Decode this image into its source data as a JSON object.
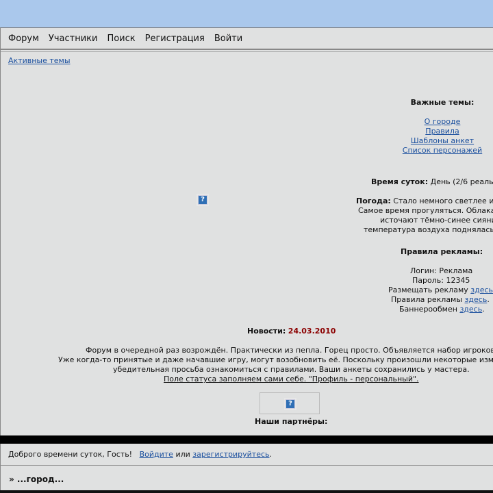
{
  "nav": {
    "items": [
      "Форум",
      "Участники",
      "Поиск",
      "Регистрация",
      "Войти"
    ]
  },
  "active_topics": "Активные темы",
  "important": {
    "title": "Важные темы:",
    "links": [
      "О городе",
      "Правила",
      "Шаблоны анкет",
      "Список персонажей"
    ]
  },
  "time": {
    "label": "Время суток:",
    "value": "День (2/6 реаль"
  },
  "weather": {
    "label": "Погода:",
    "line1": "Стало немного светлее и",
    "line2": "Самое время прогуляться. Облака",
    "line3": "источают тёмно-синее сияни",
    "line4": "температура воздуха поднялась"
  },
  "ads": {
    "title": "Правила рекламы:",
    "login": "Логин: Реклама",
    "password": "Пароль: 12345",
    "place_text": "Размещать рекламу",
    "place_link": "здесь",
    "rules_text": "Правила рекламы",
    "rules_link": "здесь",
    "banner_text": "Баннерообмен",
    "banner_link": "здесь"
  },
  "news": {
    "label": "Новости:",
    "date": "24.03.2010",
    "line1": "Форум в очередной раз возрождён. Практически из пепла. Горец просто. Объявляется набор игроков",
    "line2": "Уже когда-то принятые и даже начавшие игру, могут возобновить её. Поскольку произошли некоторые изм",
    "line3": "убедительная просьба ознакомиться с правилами. Ваши анкеты сохранились у мастера.",
    "line4": "Поле статуса заполняем сами себе. \"Профиль - персональный\"."
  },
  "partners": "Наши партнёры:",
  "welcome": {
    "greeting": "Доброго времени суток, Гость!",
    "login_link": "Войдите",
    "or": "или",
    "register_link": "зарегистрируйтесь"
  },
  "breadcrumb": "» ...город...",
  "placeholder_glyph": "?",
  "colors": {
    "top_bg": "#aac8ec",
    "panel_bg": "#e0e1e1",
    "link": "#1a4f9e",
    "date": "#8b0000"
  }
}
